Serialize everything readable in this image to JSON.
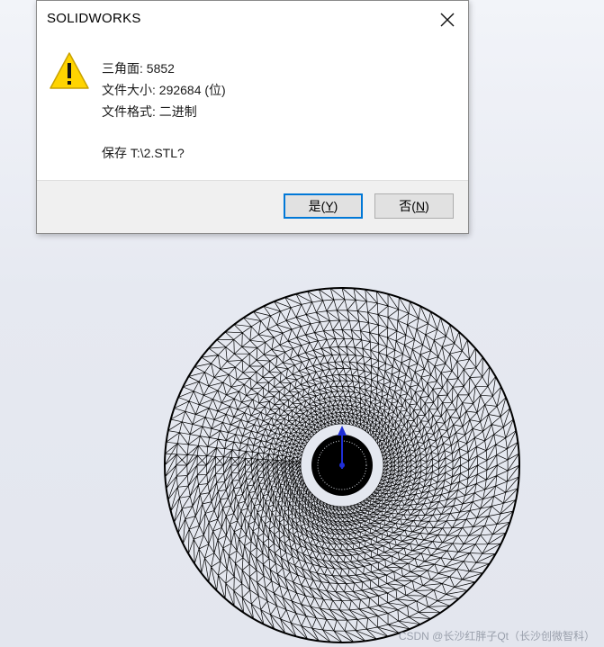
{
  "dialog": {
    "title": "SOLIDWORKS",
    "lines": [
      "三角面: 5852",
      "文件大小: 292684 (位)",
      "文件格式: 二进制",
      "保存 T:\\2.STL?"
    ],
    "buttons": {
      "yes": {
        "text": "是(",
        "mnemonic": "Y",
        "suffix": ")"
      },
      "no": {
        "text": "否(",
        "mnemonic": "N",
        "suffix": ")"
      }
    }
  },
  "watermark": "CSDN @长沙红胖子Qt（长沙创微智科）",
  "colors": {
    "warning_fill": "#ffd400",
    "primary_border": "#0078d7",
    "axis_arrow": "#1f2ed6"
  }
}
